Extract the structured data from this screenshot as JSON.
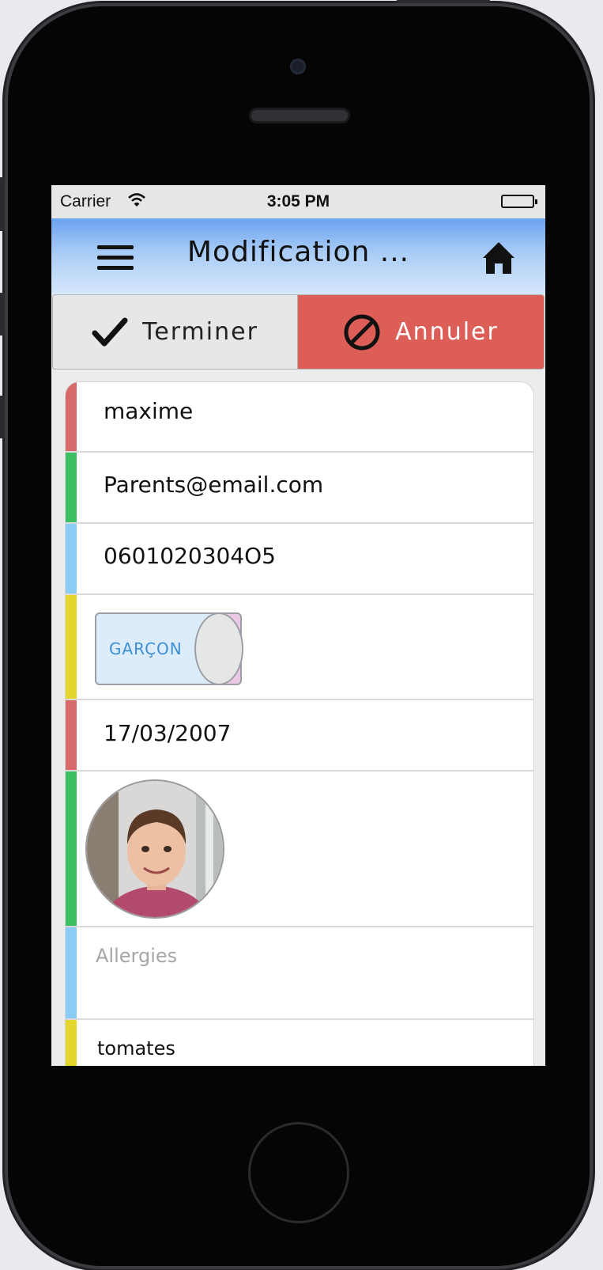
{
  "status_bar": {
    "carrier": "Carrier",
    "time": "3:05 PM"
  },
  "navbar": {
    "title": "Modification ...",
    "menu_icon": "hamburger-icon",
    "home_icon": "home-icon"
  },
  "actions": {
    "done_label": "Terminer",
    "cancel_label": "Annuler"
  },
  "colors": {
    "red": "#d66a6a",
    "green": "#3cbf62",
    "blue": "#8ccbf3",
    "yellow": "#e3d62c",
    "cancel_bg": "#dc5e57"
  },
  "form": {
    "name": "maxime",
    "email": "Parents@email.com",
    "phone": "0601020304O5",
    "gender_label": "GARÇON",
    "birthdate": "17/03/2007",
    "allergies_placeholder": "Allergies",
    "note": "tomates"
  }
}
